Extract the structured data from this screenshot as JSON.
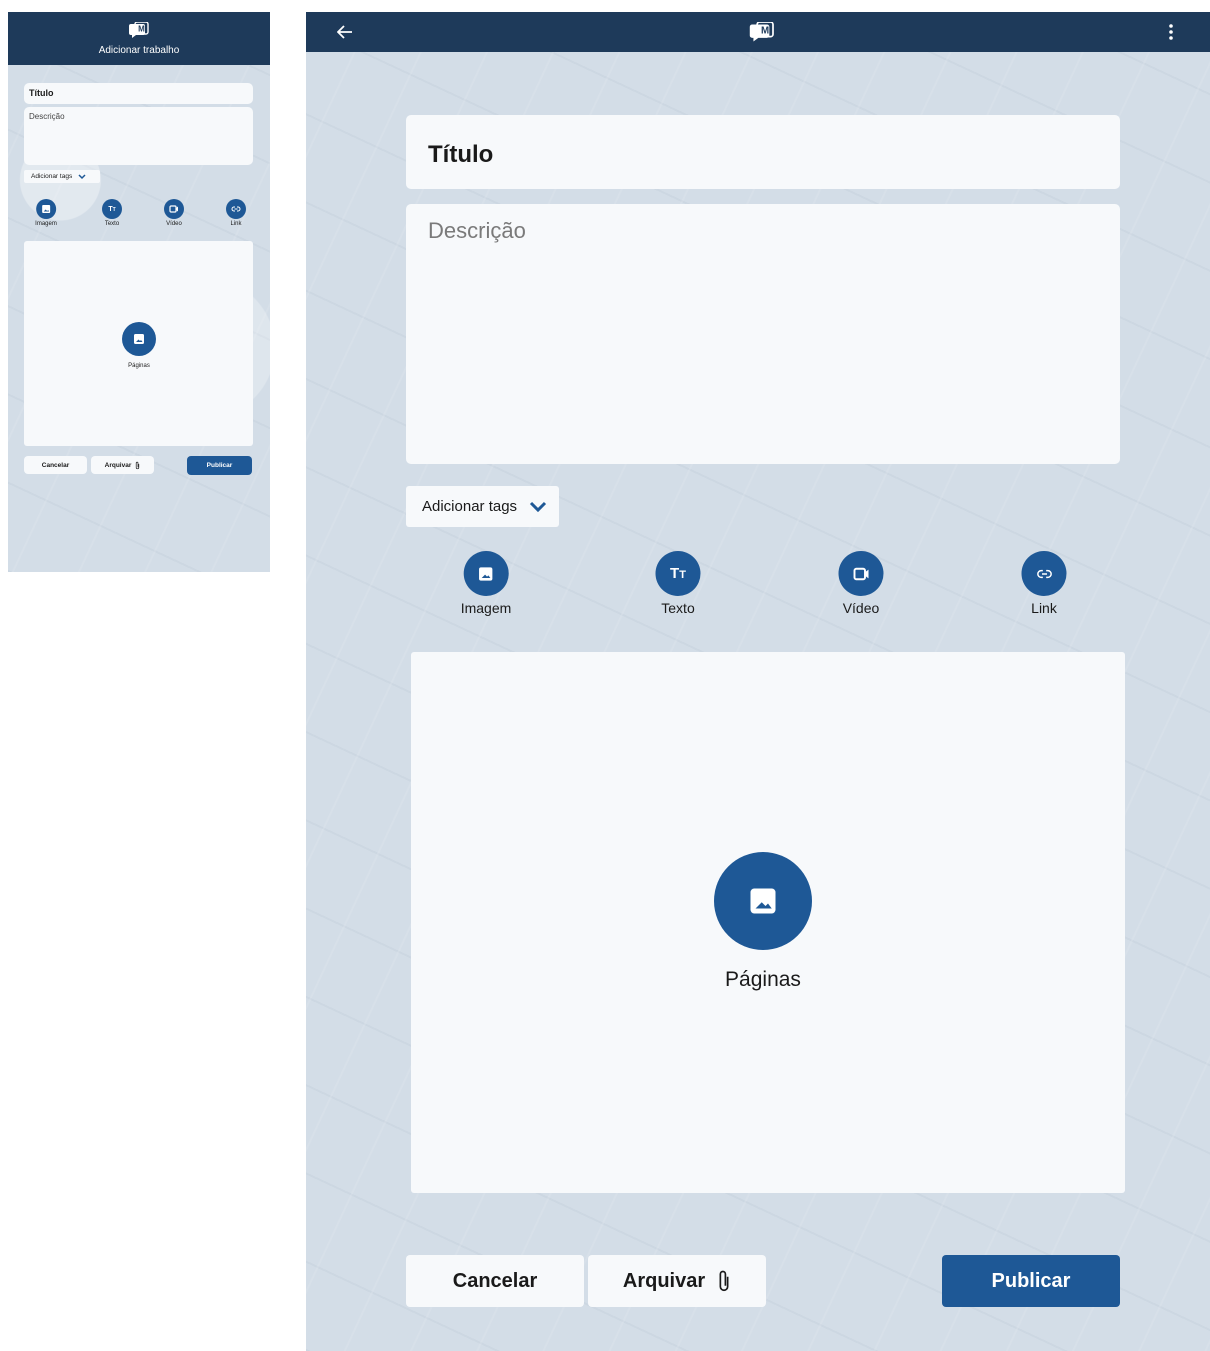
{
  "phone": {
    "header_title": "Adicionar trabalho",
    "title_field": "Título",
    "description_placeholder": "Descrição",
    "tags_label": "Adicionar tags",
    "media": [
      {
        "label": "Imagem",
        "icon": "image-icon"
      },
      {
        "label": "Texto",
        "icon": "text-icon"
      },
      {
        "label": "Vídeo",
        "icon": "video-icon"
      },
      {
        "label": "Link",
        "icon": "link-icon"
      }
    ],
    "pages_label": "Páginas",
    "cancel_label": "Cancelar",
    "archive_label": "Arquivar",
    "publish_label": "Publicar"
  },
  "tablet": {
    "title_field": "Título",
    "description_placeholder": "Descrição",
    "tags_label": "Adicionar tags",
    "media": [
      {
        "label": "Imagem",
        "icon": "image-icon"
      },
      {
        "label": "Texto",
        "icon": "text-icon"
      },
      {
        "label": "Vídeo",
        "icon": "video-icon"
      },
      {
        "label": "Link",
        "icon": "link-icon"
      }
    ],
    "pages_label": "Páginas",
    "cancel_label": "Cancelar",
    "archive_label": "Arquivar",
    "publish_label": "Publicar"
  },
  "colors": {
    "appbar": "#1e3a5a",
    "accent": "#1e5896",
    "background": "#d3dde7",
    "surface": "#f7f9fb"
  },
  "icons": [
    "back-arrow-icon",
    "logo-icon",
    "more-vert-icon",
    "chevron-down-icon",
    "image-icon",
    "text-icon",
    "video-icon",
    "link-icon",
    "paperclip-icon"
  ]
}
